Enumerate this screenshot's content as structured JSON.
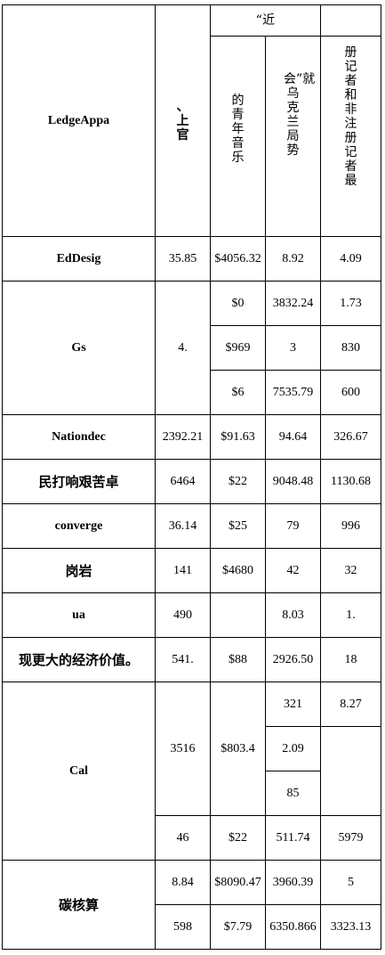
{
  "header": {
    "col0": "LedgeAppa",
    "col1": "、上官",
    "span_top": "“近",
    "col2": "的青年音乐",
    "col3": "会”就乌克兰局势",
    "col4": "册记者和非注册记者最"
  },
  "rows": {
    "edd": {
      "label": "EdDesig",
      "c1": "35.85",
      "c2": "$4056.32",
      "c3": "8.92",
      "c4": "4.09"
    },
    "gs": {
      "label": "Gs",
      "c1": "4.",
      "r1": {
        "c2": "$0",
        "c3": "3832.24",
        "c4": "1.73"
      },
      "r2": {
        "c2": "$969",
        "c3": "3",
        "c4": "830"
      },
      "r3": {
        "c2": "$6",
        "c3": "7535.79",
        "c4": "600"
      }
    },
    "nat": {
      "label": "Nationdec",
      "c1": "2392.21",
      "c2": "$91.63",
      "c3": "94.64",
      "c4": "326.67"
    },
    "min": {
      "label": "民打响艰苦卓",
      "c1": "6464",
      "c2": "$22",
      "c3": "9048.48",
      "c4": "1130.68"
    },
    "conv": {
      "label": "converge",
      "c1": "36.14",
      "c2": "$25",
      "c3": "79",
      "c4": "996"
    },
    "gang": {
      "label": "岗岩",
      "c1": "141",
      "c2": "$4680",
      "c3": "42",
      "c4": "32"
    },
    "ua": {
      "label": "ua",
      "c1": "490",
      "c2": "",
      "c3": "8.03",
      "c4": "1."
    },
    "xian": {
      "label": "现更大的经济价值。",
      "c1": "541.",
      "c2": "$88",
      "c3": "2926.50",
      "c4": "18"
    },
    "cal": {
      "label": "Cal",
      "c1": "3516",
      "c2": "$803.4",
      "r1": {
        "c3": "321",
        "c4": "8.27"
      },
      "r2": {
        "c3": "2.09"
      },
      "r3": {
        "c3": "85"
      },
      "r4": {
        "c1": "46",
        "c2": "$22",
        "c3": "511.74",
        "c4": "5979"
      }
    },
    "tan": {
      "label": "碳核算",
      "r1": {
        "c1": "8.84",
        "c2": "$8090.47",
        "c3": "3960.39",
        "c4": "5"
      },
      "r2": {
        "c1": "598",
        "c2": "$7.79",
        "c3": "6350.866",
        "c4": "3323.13"
      }
    }
  }
}
